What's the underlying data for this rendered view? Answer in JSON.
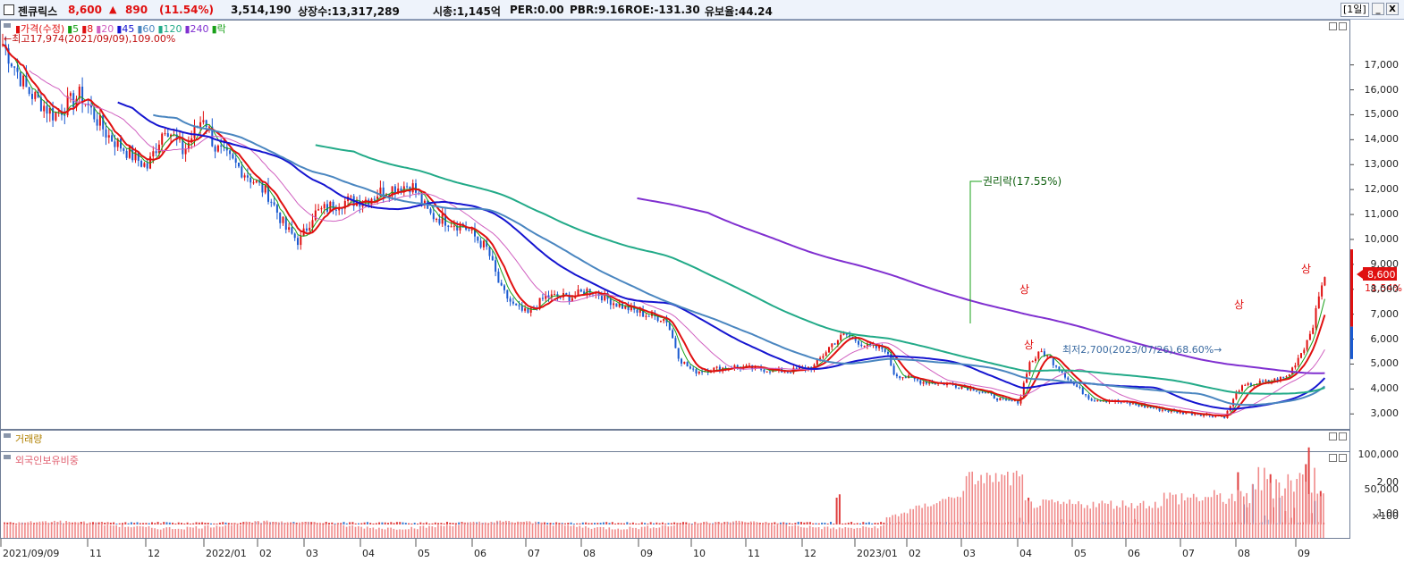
{
  "header": {
    "stock_name": "젠큐릭스",
    "price": "8,600",
    "change_arrow": "▲",
    "change": "890",
    "change_pct": "(11.54%)",
    "volume": "3,514,190",
    "listed_shares": "상장수:13,317,289",
    "market_cap": "시총:1,145억",
    "per": "PER:0.00",
    "pbr": "PBR:9.16",
    "roe": "ROE:-131.30",
    "float_ratio": "유보율:44.24",
    "period": "[1일]",
    "min_btn": "_",
    "close_btn": "X",
    "colors": {
      "up": "#e01010",
      "dark": "#111111"
    }
  },
  "price_panel": {
    "legend": [
      {
        "label": "가격(수정)",
        "color": "#e01010"
      },
      {
        "label": "5",
        "color": "#18a018"
      },
      {
        "label": "8",
        "color": "#e01010"
      },
      {
        "label": "20",
        "color": "#d060c0"
      },
      {
        "label": "45",
        "color": "#1515d0"
      },
      {
        "label": "60",
        "color": "#4a86c0"
      },
      {
        "label": "120",
        "color": "#22aa88"
      },
      {
        "label": "240",
        "color": "#8030d0"
      },
      {
        "label": "락",
        "color": "#18a018"
      }
    ],
    "high_note": "최고17,974(2021/09/09),109.00%",
    "low_note": "최저2,700(2023/07/26),68.60%",
    "rights_note": "권리락(17.55%)",
    "price_tag": "8,600",
    "pct_tag": "11.54%",
    "markers": [
      "상",
      "상",
      "상",
      "상"
    ],
    "y_ticks": [
      "17,000",
      "16,000",
      "15,000",
      "14,000",
      "13,000",
      "12,000",
      "11,000",
      "10,000",
      "9,000",
      "8,000",
      "7,000",
      "6,000",
      "5,000",
      "4,000",
      "3,000"
    ]
  },
  "volume_panel": {
    "title": "거래량",
    "y_ticks": [
      "100,000",
      "50,000",
      "×100"
    ]
  },
  "foreign_panel": {
    "title": "외국인보유비중",
    "y_ticks": [
      "2.00",
      "1.00"
    ]
  },
  "x_axis": [
    "2021/09/09",
    "11",
    "12",
    "2022/01",
    "02",
    "03",
    "04",
    "05",
    "06",
    "07",
    "08",
    "09",
    "10",
    "11",
    "12",
    "2023/01",
    "02",
    "03",
    "04",
    "05",
    "06",
    "07",
    "08",
    "09"
  ],
  "chart_data": {
    "type": "candlestick",
    "title": "젠큐릭스",
    "ylim": [
      2400,
      18600
    ],
    "price_x": [
      "2021/09",
      "2021/10",
      "2021/11",
      "2021/12",
      "2022/01",
      "2022/02",
      "2022/03",
      "2022/04",
      "2022/05",
      "2022/06",
      "2022/07",
      "2022/08",
      "2022/09",
      "2022/10",
      "2022/11",
      "2022/12",
      "2023/01",
      "2023/02",
      "2023/03",
      "2023/04",
      "2023/05",
      "2023/06",
      "2023/07",
      "2023/08",
      "2023/09"
    ],
    "close_approx": [
      16000,
      15200,
      13900,
      14200,
      13600,
      11500,
      11200,
      11800,
      10200,
      7300,
      7500,
      6900,
      4700,
      4800,
      4700,
      5700,
      4300,
      4000,
      3500,
      5200,
      3600,
      3200,
      2900,
      4300,
      8600
    ],
    "volume_ylim": [
      0,
      120000
    ],
    "foreign_ratio_ylim": [
      0,
      2.6
    ]
  }
}
